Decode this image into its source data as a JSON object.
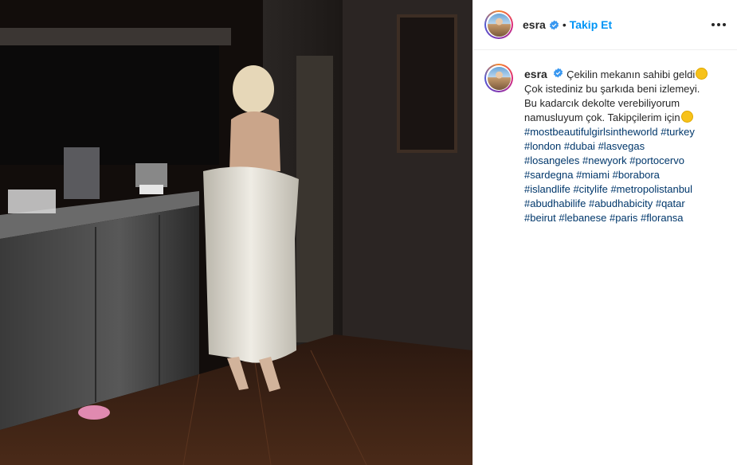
{
  "post": {
    "username": "esra",
    "dot": "•",
    "follow_label": "Takip Et",
    "verified_icon": "verified-badge-icon",
    "more_icon": "more-options-icon"
  },
  "caption": {
    "username": "esra",
    "lines": [
      "Çekilin mekanın sahibi geldi",
      "Çok istediniz bu şarkıda beni izlemeyi.",
      "Bu kadarcık dekolte verebiliyorum",
      "namusluyum çok. Takipçilerim için"
    ],
    "hashtag_lines": [
      [
        "#mostbeautifulgirlsintheworld",
        "#turkey"
      ],
      [
        "#london",
        "#dubai",
        "#lasvegas"
      ],
      [
        "#losangeles",
        "#newyork",
        "#portocervo"
      ],
      [
        "#sardegna",
        "#miami",
        "#borabora"
      ],
      [
        "#islandlife",
        "#citylife",
        "#metropolistanbul"
      ],
      [
        "#abudhabilife",
        "#abudhabicity",
        "#qatar"
      ],
      [
        "#beirut",
        "#lebanese",
        "#paris",
        "#floransa"
      ]
    ]
  },
  "colors": {
    "link": "#0095f6",
    "hashtag": "#00376b",
    "text": "#262626",
    "divider": "#efefef"
  }
}
